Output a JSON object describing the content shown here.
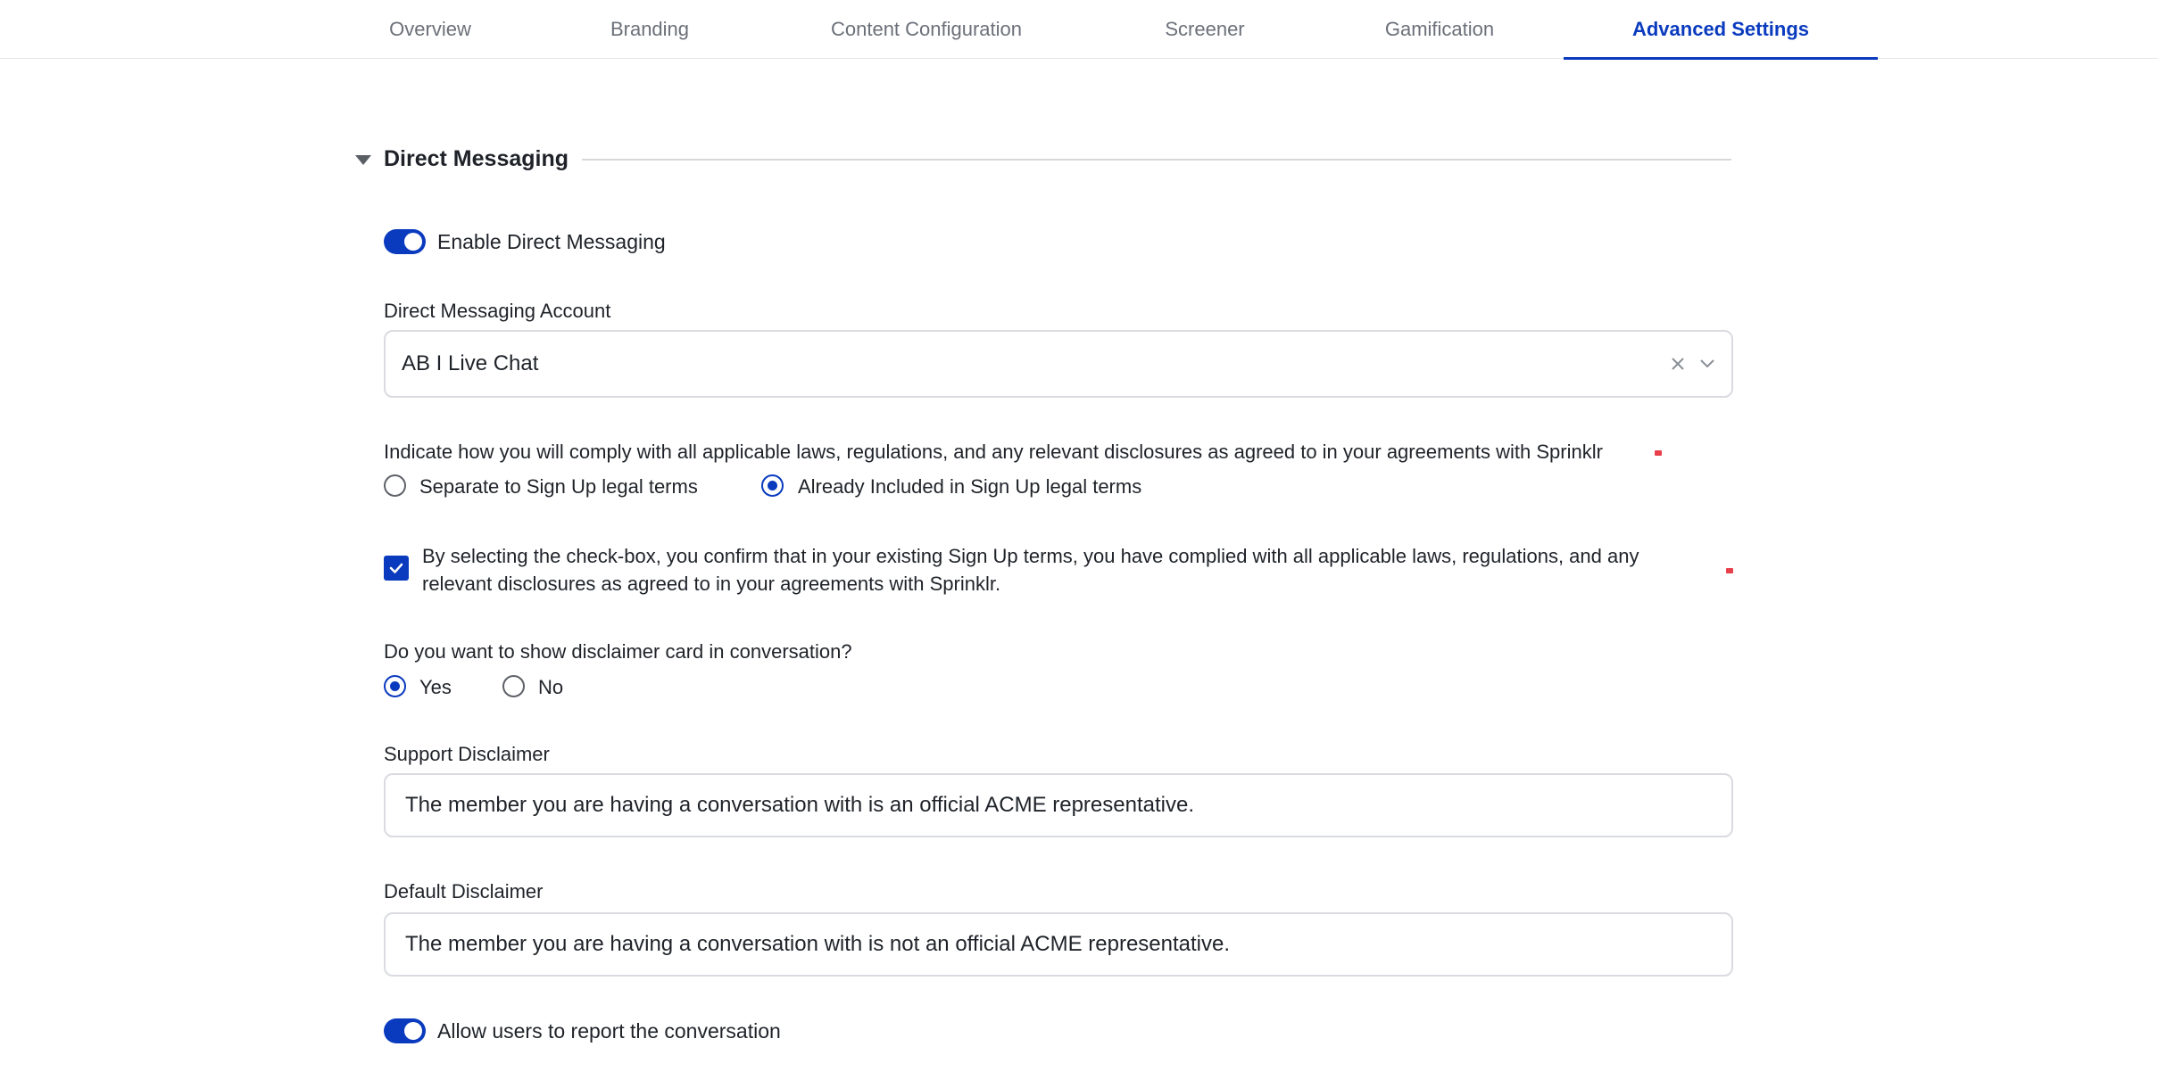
{
  "tabs": [
    {
      "label": "Overview"
    },
    {
      "label": "Branding"
    },
    {
      "label": "Content Configuration"
    },
    {
      "label": "Screener"
    },
    {
      "label": "Gamification"
    },
    {
      "label": "Advanced Settings",
      "active": true
    }
  ],
  "section": {
    "title": "Direct Messaging"
  },
  "enable_dm": {
    "label": "Enable Direct Messaging",
    "on": true
  },
  "dm_account": {
    "label": "Direct Messaging Account",
    "value": "AB I Live Chat"
  },
  "compliance": {
    "question": "Indicate how you will comply with all applicable laws, regulations, and any relevant disclosures as agreed to in your agreements with Sprinklr",
    "options": [
      {
        "label": "Separate to Sign Up legal terms",
        "selected": false
      },
      {
        "label": "Already Included in Sign Up legal terms",
        "selected": true
      }
    ]
  },
  "confirm": {
    "checked": true,
    "line1": "By selecting the check-box, you confirm that in your existing Sign Up terms, you have complied with all applicable laws, regulations, and any",
    "line2": "relevant disclosures as agreed to in your agreements with Sprinklr."
  },
  "disclaimer_card": {
    "question": "Do you want to show disclaimer card in conversation?",
    "options": [
      {
        "label": "Yes",
        "selected": true
      },
      {
        "label": "No",
        "selected": false
      }
    ]
  },
  "support_disclaimer": {
    "label": "Support Disclaimer",
    "value": "The member you are having a conversation with is an official ACME representative."
  },
  "default_disclaimer": {
    "label": "Default Disclaimer",
    "value": "The member you are having a conversation with is not an official ACME representative."
  },
  "report": {
    "label": "Allow users to report the conversation",
    "on": true
  },
  "colors": {
    "accent": "#0a3bbf",
    "required": "#e8404b",
    "border": "#d9dbe0"
  }
}
